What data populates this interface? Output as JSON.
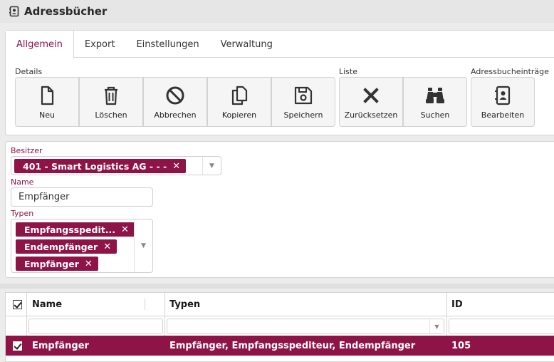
{
  "window": {
    "title": "Adressbücher",
    "icon": "address-book-icon"
  },
  "tabs": [
    {
      "label": "Allgemein",
      "active": true
    },
    {
      "label": "Export",
      "active": false
    },
    {
      "label": "Einstellungen",
      "active": false
    },
    {
      "label": "Verwaltung",
      "active": false
    }
  ],
  "toolbar": {
    "groups": {
      "details": "Details",
      "liste": "Liste",
      "adressbucheintraege": "Adressbucheinträge"
    },
    "buttons": {
      "neu": "Neu",
      "loeschen": "Löschen",
      "abbrechen": "Abbrechen",
      "kopieren": "Kopieren",
      "speichern": "Speichern",
      "zuruecksetzen": "Zurücksetzen",
      "suchen": "Suchen",
      "bearbeiten": "Bearbeiten"
    }
  },
  "form": {
    "besitzer": {
      "label": "Besitzer",
      "value": "401 - Smart Logistics AG - - -"
    },
    "name": {
      "label": "Name",
      "value": "Empfänger"
    },
    "typen": {
      "label": "Typen",
      "values": [
        "Empfangsspedit...",
        "Endempfänger",
        "Empfänger"
      ]
    }
  },
  "grid": {
    "columns": {
      "name": "Name",
      "typen": "Typen",
      "id": "ID"
    },
    "rows": [
      {
        "name": "Empfänger",
        "typen": "Empfänger, Empfangsspediteur, Endempfänger",
        "id": "105",
        "selected": true
      }
    ]
  },
  "colors": {
    "accent": "#8e1447"
  }
}
